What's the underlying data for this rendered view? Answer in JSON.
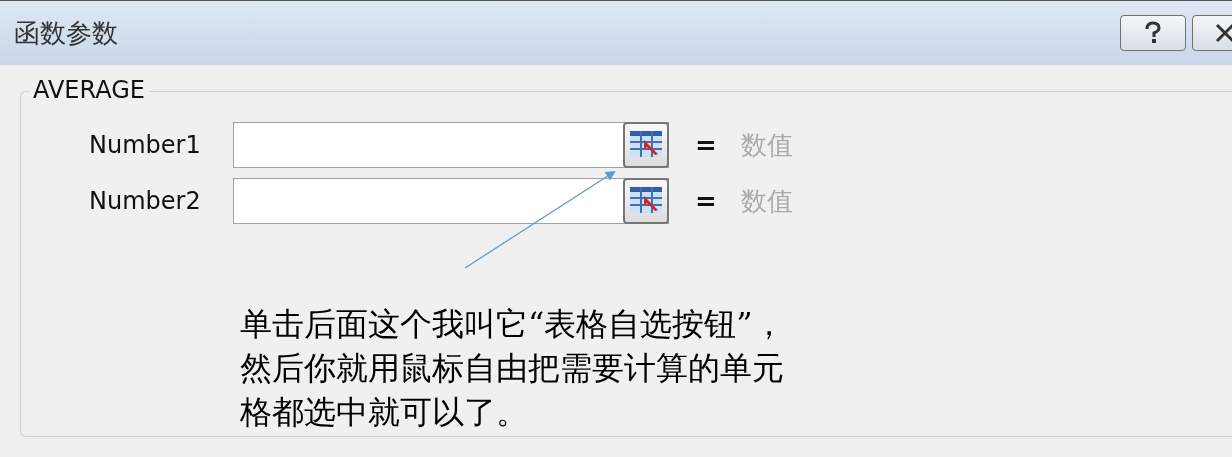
{
  "window": {
    "title": "函数参数"
  },
  "group": {
    "title": "AVERAGE",
    "arguments": [
      {
        "label": "Number1",
        "result": "数值"
      },
      {
        "label": "Number2",
        "result": "数值"
      }
    ],
    "equals_sign": "="
  },
  "annotation": {
    "lines": [
      "单击后面这个我叫它“表格自选按钮”，",
      "然后你就用鼠标自由把需要计算的单元",
      "格都选中就可以了。"
    ]
  }
}
